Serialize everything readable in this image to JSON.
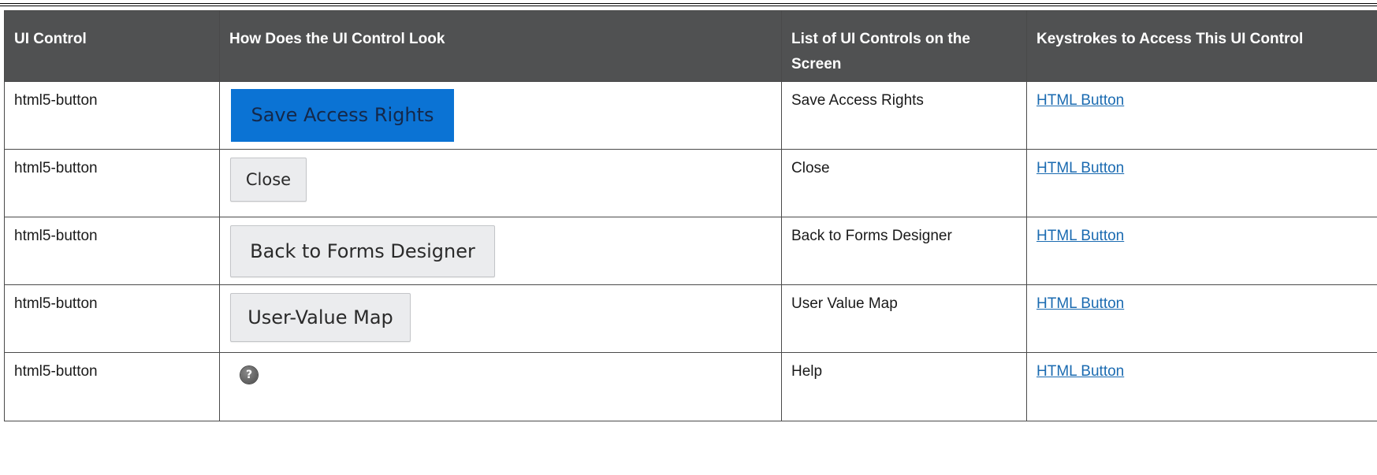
{
  "table": {
    "headers": [
      "UI Control",
      "How Does the UI Control Look",
      "List of UI Controls on the Screen",
      "Keystrokes to Access This UI Control"
    ],
    "rows": [
      {
        "ui_control": "html5-button",
        "look_label": "Save Access Rights",
        "control_name": "Save Access Rights",
        "keystrokes_link": "HTML Button"
      },
      {
        "ui_control": "html5-button",
        "look_label": "Close",
        "control_name": "Close",
        "keystrokes_link": "HTML Button"
      },
      {
        "ui_control": "html5-button",
        "look_label": "Back to Forms Designer",
        "control_name": "Back to Forms Designer",
        "keystrokes_link": "HTML Button"
      },
      {
        "ui_control": "html5-button",
        "look_label": "User-Value Map",
        "control_name": "User Value Map",
        "keystrokes_link": "HTML Button"
      },
      {
        "ui_control": "html5-button",
        "look_label": "?",
        "control_name": "Help",
        "keystrokes_link": "HTML Button"
      }
    ]
  },
  "icons": {
    "help": "help-icon"
  },
  "colors": {
    "header_bg": "#505152",
    "primary_button": "#0b73d4",
    "link": "#1b6bb1"
  }
}
